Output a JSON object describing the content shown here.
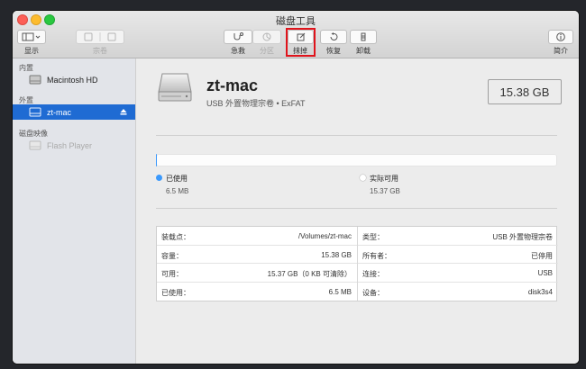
{
  "window": {
    "title": "磁盘工具"
  },
  "toolbar": {
    "show_label": "显示",
    "volume_label": "宗卷",
    "first_aid_label": "急救",
    "partition_label": "分区",
    "erase_label": "抹掉",
    "restore_label": "恢复",
    "unmount_label": "卸载",
    "info_label": "简介"
  },
  "sidebar": {
    "internal_heading": "内置",
    "internal_item": "Macintosh HD",
    "external_heading": "外置",
    "external_item": "zt-mac",
    "images_heading": "磁盘映像",
    "images_item": "Flash Player"
  },
  "disk": {
    "name": "zt-mac",
    "description": "USB 外置物理宗卷 • ExFAT",
    "capacity": "15.38 GB"
  },
  "usage": {
    "used_fraction": 0.0004,
    "used_label": "已使用",
    "used_value": "6.5 MB",
    "free_label": "实际可用",
    "free_value": "15.37 GB",
    "used_color": "#3b99fc"
  },
  "info": {
    "left": [
      {
        "key": "装载点：",
        "value": "/Volumes/zt-mac"
      },
      {
        "key": "容量：",
        "value": "15.38 GB"
      },
      {
        "key": "可用：",
        "value": "15.37 GB（0 KB 可清除）"
      },
      {
        "key": "已使用：",
        "value": "6.5 MB"
      }
    ],
    "right": [
      {
        "key": "类型：",
        "value": "USB 外置物理宗卷"
      },
      {
        "key": "所有者：",
        "value": "已停用"
      },
      {
        "key": "连接：",
        "value": "USB"
      },
      {
        "key": "设备：",
        "value": "disk3s4"
      }
    ]
  }
}
